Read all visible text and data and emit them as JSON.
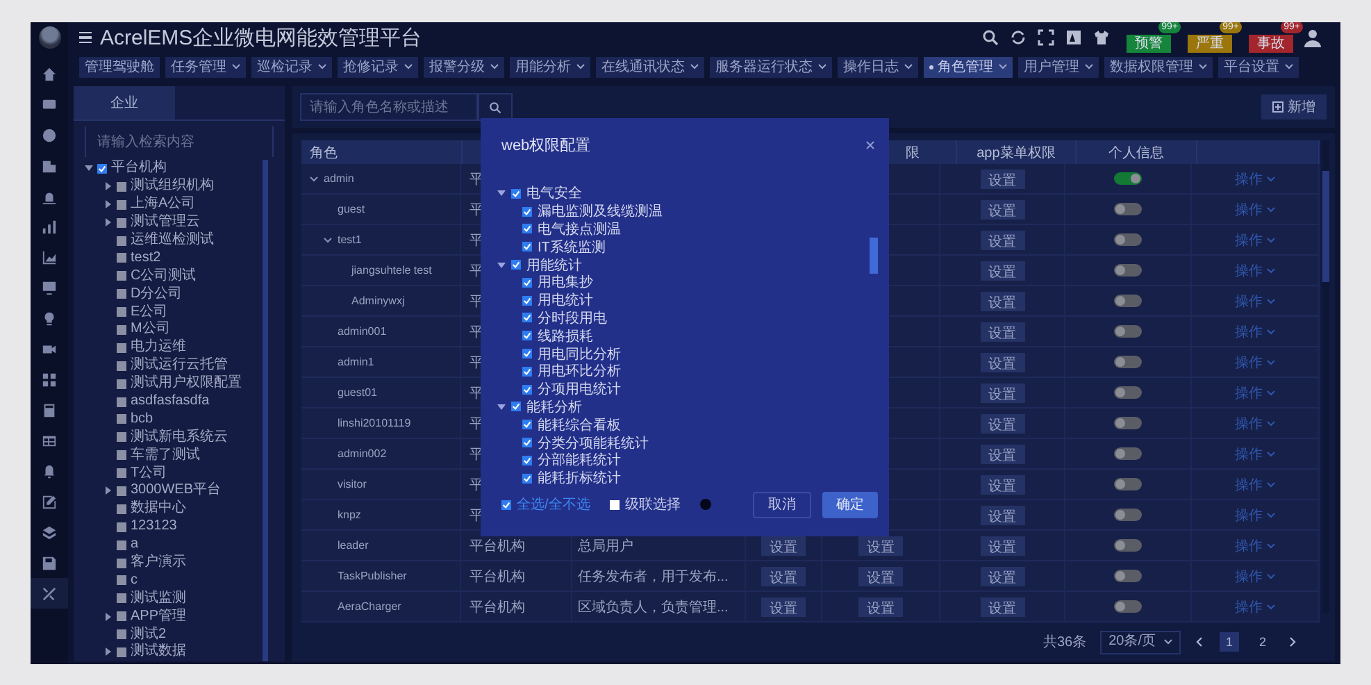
{
  "header": {
    "title": "AcrelEMS企业微电网能效管理平台",
    "alerts": [
      {
        "label": "预警",
        "count": "99+",
        "color": "#14853a"
      },
      {
        "label": "严重",
        "count": "99+",
        "color": "#9a760c"
      },
      {
        "label": "事故",
        "count": "99+",
        "color": "#a2262c"
      }
    ]
  },
  "tabs": [
    {
      "label": "管理驾驶舱",
      "dropdown": false,
      "selected": false
    },
    {
      "label": "任务管理",
      "dropdown": true,
      "selected": false
    },
    {
      "label": "巡检记录",
      "dropdown": true,
      "selected": false
    },
    {
      "label": "抢修记录",
      "dropdown": true,
      "selected": false
    },
    {
      "label": "报警分级",
      "dropdown": true,
      "selected": false
    },
    {
      "label": "用能分析",
      "dropdown": true,
      "selected": false
    },
    {
      "label": "在线通讯状态",
      "dropdown": true,
      "selected": false
    },
    {
      "label": "服务器运行状态",
      "dropdown": true,
      "selected": false
    },
    {
      "label": "操作日志",
      "dropdown": true,
      "selected": false
    },
    {
      "label": "角色管理",
      "dropdown": true,
      "selected": true
    },
    {
      "label": "用户管理",
      "dropdown": true,
      "selected": false
    },
    {
      "label": "数据权限管理",
      "dropdown": true,
      "selected": false
    },
    {
      "label": "平台设置",
      "dropdown": true,
      "selected": false
    }
  ],
  "org_panel": {
    "tab": {
      "label": "企业",
      "selected": true
    },
    "search_placeholder": "请输入检索内容",
    "tree": [
      {
        "label": "平台机构",
        "checked": true,
        "expanded": true,
        "children": [
          {
            "label": "测试组织机构",
            "checked": false,
            "expanded": false,
            "has_children": true
          },
          {
            "label": "上海A公司",
            "checked": false,
            "expanded": false,
            "has_children": true
          },
          {
            "label": "测试管理云",
            "checked": false,
            "expanded": false,
            "has_children": true
          },
          {
            "label": "运维巡检测试",
            "checked": false,
            "expanded": false,
            "has_children": false
          },
          {
            "label": "test2",
            "checked": false,
            "expanded": false,
            "has_children": false
          },
          {
            "label": "C公司测试",
            "checked": false,
            "expanded": false,
            "has_children": false
          },
          {
            "label": "D分公司",
            "checked": false,
            "expanded": false,
            "has_children": false
          },
          {
            "label": "E公司",
            "checked": false,
            "expanded": false,
            "has_children": false
          },
          {
            "label": "M公司",
            "checked": false,
            "expanded": false,
            "has_children": false
          },
          {
            "label": "电力运维",
            "checked": false,
            "expanded": false,
            "has_children": false
          },
          {
            "label": "测试运行云托管",
            "checked": false,
            "expanded": false,
            "has_children": false
          },
          {
            "label": "测试用户权限配置",
            "checked": false,
            "expanded": false,
            "has_children": false
          },
          {
            "label": "asdfasfasdfa",
            "checked": false,
            "expanded": false,
            "has_children": false
          },
          {
            "label": "bcb",
            "checked": false,
            "expanded": false,
            "has_children": false
          },
          {
            "label": "测试新电系统云",
            "checked": false,
            "expanded": false,
            "has_children": false
          },
          {
            "label": "车需了测试",
            "checked": false,
            "expanded": false,
            "has_children": false
          },
          {
            "label": "T公司",
            "checked": false,
            "expanded": false,
            "has_children": false
          },
          {
            "label": "3000WEB平台",
            "checked": false,
            "expanded": false,
            "has_children": true
          },
          {
            "label": "数据中心",
            "checked": false,
            "expanded": false,
            "has_children": false
          },
          {
            "label": "123123",
            "checked": false,
            "expanded": false,
            "has_children": false
          },
          {
            "label": "a",
            "checked": false,
            "expanded": false,
            "has_children": false
          },
          {
            "label": "客户演示",
            "checked": false,
            "expanded": false,
            "has_children": false
          },
          {
            "label": "c",
            "checked": false,
            "expanded": false,
            "has_children": false
          },
          {
            "label": "测试监测",
            "checked": false,
            "expanded": false,
            "has_children": false
          },
          {
            "label": "APP管理",
            "checked": false,
            "expanded": false,
            "has_children": true
          },
          {
            "label": "测试2",
            "checked": false,
            "expanded": false,
            "has_children": false
          },
          {
            "label": "测试数据",
            "checked": false,
            "expanded": false,
            "has_children": true
          }
        ]
      }
    ]
  },
  "roles": {
    "search_placeholder": "请输入角色名称或描述",
    "add_button": "新增",
    "headers": {
      "role": "角色",
      "column_5": "限",
      "app_menu": "app菜单权限",
      "personal_info": "个人信息"
    },
    "rows": [
      {
        "role": "admin",
        "expanded": true,
        "column_2": "平",
        "app_button": "设置",
        "personal_info_on": true,
        "action": "操作",
        "children": [
          {
            "role": "guest",
            "column_2": "平",
            "app_button": "设置",
            "personal_info_on": false,
            "action": "操作"
          },
          {
            "role": "test1",
            "expanded": true,
            "column_2": "平",
            "app_button": "设置",
            "personal_info_on": false,
            "action": "操作",
            "children": [
              {
                "role": "jiangsuhtele test",
                "column_2": "平",
                "app_button": "设置",
                "personal_info_on": false,
                "action": "操作"
              },
              {
                "role": "Adminywxj",
                "column_2": "平",
                "app_button": "设置",
                "personal_info_on": false,
                "action": "操作"
              }
            ]
          },
          {
            "role": "admin001",
            "column_2": "平",
            "app_button": "设置",
            "personal_info_on": false,
            "action": "操作"
          },
          {
            "role": "admin1",
            "column_2": "平",
            "app_button": "设置",
            "personal_info_on": false,
            "action": "操作"
          },
          {
            "role": "guest01",
            "column_2": "平",
            "app_button": "设置",
            "personal_info_on": false,
            "action": "操作"
          },
          {
            "role": "linshi20101119",
            "column_2": "平",
            "app_button": "设置",
            "personal_info_on": false,
            "action": "操作"
          },
          {
            "role": "admin002",
            "column_2": "平",
            "app_button": "设置",
            "personal_info_on": false,
            "action": "操作"
          },
          {
            "role": "visitor",
            "column_2": "平",
            "app_button": "设置",
            "personal_info_on": false,
            "action": "操作"
          },
          {
            "role": "knpz",
            "column_2": "平",
            "app_button": "设置",
            "personal_info_on": false,
            "action": "操作"
          },
          {
            "role": "leader",
            "column_2": "平台机构",
            "description": "总局用户",
            "data_button": "设置",
            "web_button": "设置",
            "app_button": "设置",
            "personal_info_on": false,
            "action": "操作"
          },
          {
            "role": "TaskPublisher",
            "column_2": "平台机构",
            "description": "任务发布者，用于发布...",
            "data_button": "设置",
            "web_button": "设置",
            "app_button": "设置",
            "personal_info_on": false,
            "action": "操作"
          },
          {
            "role": "AeraCharger",
            "column_2": "平台机构",
            "description": "区域负责人，负责管理...",
            "data_button": "设置",
            "web_button": "设置",
            "app_button": "设置",
            "personal_info_on": false,
            "action": "操作"
          }
        ]
      }
    ]
  },
  "pagination": {
    "total": "共36条",
    "page_size": "20条/页",
    "pages": [
      {
        "label": "1",
        "selected": true
      },
      {
        "label": "2",
        "selected": false
      }
    ]
  },
  "modal": {
    "title": "web权限配置",
    "groups": [
      {
        "label": "电气安全",
        "checked": true,
        "expanded": true,
        "children": [
          {
            "label": "漏电监测及线缆测温",
            "checked": true
          },
          {
            "label": "电气接点测温",
            "checked": true
          },
          {
            "label": "IT系统监测",
            "checked": true
          }
        ]
      },
      {
        "label": "用能统计",
        "checked": true,
        "expanded": true,
        "children": [
          {
            "label": "用电集抄",
            "checked": true
          },
          {
            "label": "用电统计",
            "checked": true
          },
          {
            "label": "分时段用电",
            "checked": true
          },
          {
            "label": "线路损耗",
            "checked": true
          },
          {
            "label": "用电同比分析",
            "checked": true
          },
          {
            "label": "用电环比分析",
            "checked": true
          },
          {
            "label": "分项用电统计",
            "checked": true
          }
        ]
      },
      {
        "label": "能耗分析",
        "checked": true,
        "expanded": true,
        "children": [
          {
            "label": "能耗综合看板",
            "checked": true
          },
          {
            "label": "分类分项能耗统计",
            "checked": true
          },
          {
            "label": "分部能耗统计",
            "checked": true
          },
          {
            "label": "能耗折标统计",
            "checked": true
          }
        ]
      }
    ],
    "select_all": {
      "label": "全选/全不选",
      "checked": true
    },
    "cascade": {
      "label": "级联选择",
      "checked": false
    },
    "buttons": [
      {
        "label": "取消",
        "kind": "secondary"
      },
      {
        "label": "确定",
        "kind": "primary"
      }
    ]
  }
}
